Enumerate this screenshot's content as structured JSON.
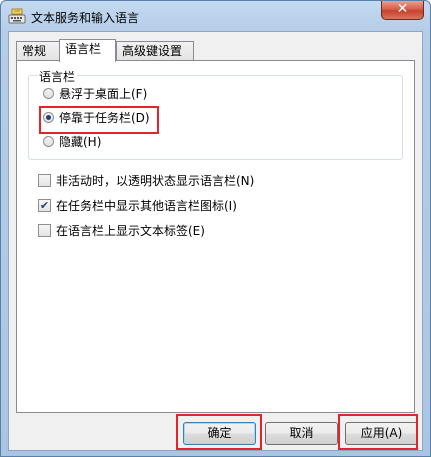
{
  "window": {
    "title": "文本服务和输入语言",
    "close_glyph": "✕"
  },
  "tabs": [
    {
      "label": "常规",
      "active": false
    },
    {
      "label": "语言栏",
      "active": true
    },
    {
      "label": "高级键设置",
      "active": false
    }
  ],
  "language_bar_group": {
    "legend": "语言栏",
    "options": [
      {
        "label": "悬浮于桌面上(F)",
        "checked": false
      },
      {
        "label": "停靠于任务栏(D)",
        "checked": true
      },
      {
        "label": "隐藏(H)",
        "checked": false
      }
    ]
  },
  "checkboxes": [
    {
      "label": "非活动时，以透明状态显示语言栏(N)",
      "checked": false
    },
    {
      "label": "在任务栏中显示其他语言栏图标(I)",
      "checked": true
    },
    {
      "label": "在语言栏上显示文本标签(E)",
      "checked": false
    }
  ],
  "buttons": {
    "ok": "确定",
    "cancel": "取消",
    "apply": "应用(A)"
  },
  "colors": {
    "highlight": "#e3242b",
    "title_bar": "#b5cde8",
    "close_button": "#c7412c"
  },
  "icons": {
    "app_icon": "keyboard-icon",
    "close": "close-icon",
    "check": "✔"
  }
}
